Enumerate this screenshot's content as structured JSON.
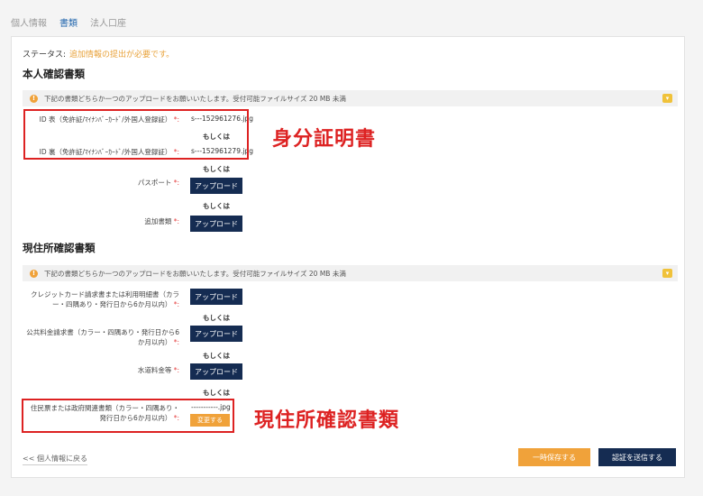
{
  "tabs": [
    "個人情報",
    "書類",
    "法人口座"
  ],
  "status": {
    "label": "ステータス:",
    "value": "追加情報の提出が必要です。"
  },
  "identity": {
    "title": "本人確認書類",
    "notice": "下記の書類どちらか一つのアップロードをお願いいたします。受付可能ファイルサイズ 20 MB 未満",
    "id_front": {
      "label": "ID 表（免許証/ﾏｲﾅﾝﾊﾞｰｶｰﾄﾞ/外国人登録証）",
      "file": "s---152961276.jpg"
    },
    "or1": "もしくは",
    "id_back": {
      "label": "ID 裏（免許証/ﾏｲﾅﾝﾊﾞｰｶｰﾄﾞ/外国人登録証）",
      "file": "s---152961279.jpg"
    },
    "or2": "もしくは",
    "passport": {
      "label": "パスポート"
    },
    "or3": "もしくは",
    "additional": {
      "label": "追加書類"
    }
  },
  "address": {
    "title": "現住所確認書類",
    "notice": "下記の書類どちらか一つのアップロードをお願いいたします。受付可能ファイルサイズ 20 MB 未満",
    "credit": {
      "label1": "クレジットカード請求書または利用明細書（カラ",
      "label2": "ー・四隅あり・発行日から6か月以内）"
    },
    "or1": "もしくは",
    "utility": {
      "label1": "公共料金請求書（カラー・四隅あり・発行日から6",
      "label2": "か月以内）"
    },
    "or2": "もしくは",
    "water": {
      "label": "水道料金等"
    },
    "or3": "もしくは",
    "resident": {
      "label1": "住民票または政府関連書類（カラー・四隅あり・",
      "label2": "発行日から6か月以内）",
      "file": "-----------.jpg"
    }
  },
  "required_mark": "*:",
  "upload_label": "アップロード",
  "change_label": "変更する",
  "annotations": {
    "identity": "身分証明書",
    "address": "現住所確認書類"
  },
  "footer": {
    "back": "<< 個人情報に戻る",
    "save": "一時保存する",
    "submit": "認証を送信する"
  }
}
